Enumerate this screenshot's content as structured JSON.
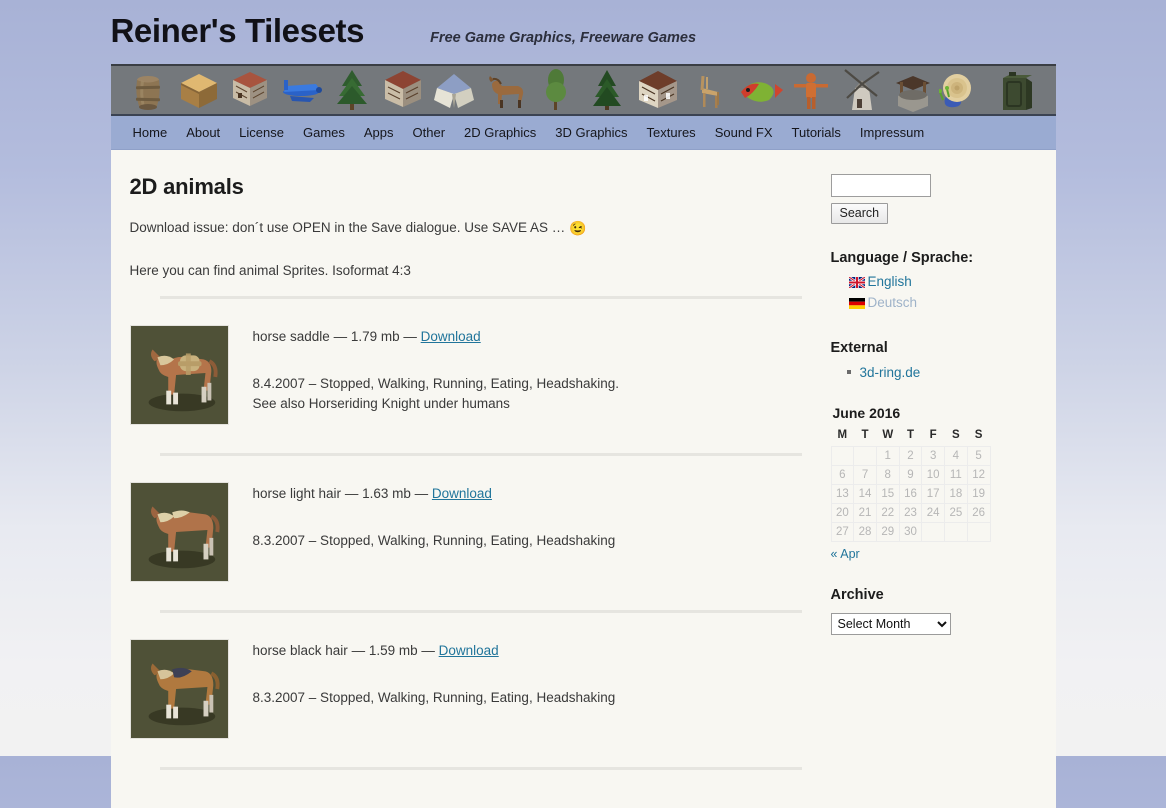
{
  "site": {
    "title": "Reiner's Tilesets",
    "tagline": "Free Game Graphics, Freeware Games"
  },
  "banner": {
    "icons": [
      "barrel-icon",
      "crate-icon",
      "timber-house-icon",
      "airplane-icon",
      "pine-tree-icon",
      "timber-house-2-icon",
      "tent-icon",
      "horse-icon",
      "pine-tree-2-icon",
      "pine-tree-3-icon",
      "house-icon",
      "chair-icon",
      "fish-icon",
      "diver-icon",
      "windmill-icon",
      "well-icon",
      "snail-icon",
      "jerrycan-icon",
      "soldier-icon"
    ]
  },
  "nav": {
    "items": [
      {
        "label": "Home",
        "name": "nav-home"
      },
      {
        "label": "About",
        "name": "nav-about"
      },
      {
        "label": "License",
        "name": "nav-license"
      },
      {
        "label": "Games",
        "name": "nav-games"
      },
      {
        "label": "Apps",
        "name": "nav-apps"
      },
      {
        "label": "Other",
        "name": "nav-other"
      },
      {
        "label": "2D Graphics",
        "name": "nav-2d-graphics"
      },
      {
        "label": "3D Graphics",
        "name": "nav-3d-graphics"
      },
      {
        "label": "Textures",
        "name": "nav-textures"
      },
      {
        "label": "Sound FX",
        "name": "nav-sound-fx"
      },
      {
        "label": "Tutorials",
        "name": "nav-tutorials"
      },
      {
        "label": "Impressum",
        "name": "nav-impressum"
      }
    ]
  },
  "content": {
    "title": "2D animals",
    "notice": "Download issue: don´t use OPEN in the Save dialogue. Use SAVE AS … ",
    "notice_emoji": "😉",
    "intro": "Here you can find animal Sprites. Isoformat 4:3",
    "items": [
      {
        "name": "horse saddle",
        "size": "1.79 mb",
        "download_label": "Download",
        "sep": "—",
        "desc_line1": "8.4.2007 – Stopped, Walking, Running, Eating, Headshaking.",
        "desc_line2": "See also Horseriding Knight under humans",
        "thumb_name": "horse-saddle-thumbnail",
        "body_color": "#b4744a",
        "mane_color": "#d8c79c",
        "saddle": true,
        "saddle_color": "#c9b27e"
      },
      {
        "name": "horse light hair",
        "size": "1.63 mb",
        "download_label": "Download",
        "sep": "—",
        "desc_line1": "8.3.2007 – Stopped, Walking, Running, Eating, Headshaking",
        "desc_line2": "",
        "thumb_name": "horse-light-hair-thumbnail",
        "body_color": "#b0734a",
        "mane_color": "#ddd0a8",
        "saddle": false,
        "saddle_color": ""
      },
      {
        "name": "horse black hair",
        "size": "1.59 mb",
        "download_label": "Download",
        "sep": "—",
        "desc_line1": "8.3.2007 – Stopped, Walking, Running, Eating, Headshaking",
        "desc_line2": "",
        "thumb_name": "horse-black-hair-thumbnail",
        "body_color": "#b0793f",
        "mane_color": "#3d4055",
        "saddle": false,
        "saddle_color": ""
      }
    ]
  },
  "sidebar": {
    "search": {
      "value": "",
      "placeholder": "",
      "button_label": "Search"
    },
    "language": {
      "title": "Language / Sprache:",
      "options": [
        {
          "label": "English",
          "flag": "uk-flag-icon",
          "active": true
        },
        {
          "label": "Deutsch",
          "flag": "german-flag-icon",
          "active": false
        }
      ]
    },
    "external": {
      "title": "External",
      "links": [
        {
          "label": "3d-ring.de"
        }
      ]
    },
    "calendar": {
      "caption": "June 2016",
      "weekdays": [
        "M",
        "T",
        "W",
        "T",
        "F",
        "S",
        "S"
      ],
      "leading_blanks": 2,
      "days": [
        1,
        2,
        3,
        4,
        5,
        6,
        7,
        8,
        9,
        10,
        11,
        12,
        13,
        14,
        15,
        16,
        17,
        18,
        19,
        20,
        21,
        22,
        23,
        24,
        25,
        26,
        27,
        28,
        29,
        30
      ],
      "prev_label": "« Apr"
    },
    "archive": {
      "title": "Archive",
      "selected": "Select Month",
      "options": [
        "Select Month"
      ]
    }
  },
  "colors": {
    "nav_bg": "#9aabd2",
    "banner_bg": "#74787c",
    "page_bg": "#f8f7f2",
    "link": "#21759b",
    "thumb_bg": "#4f5137"
  }
}
